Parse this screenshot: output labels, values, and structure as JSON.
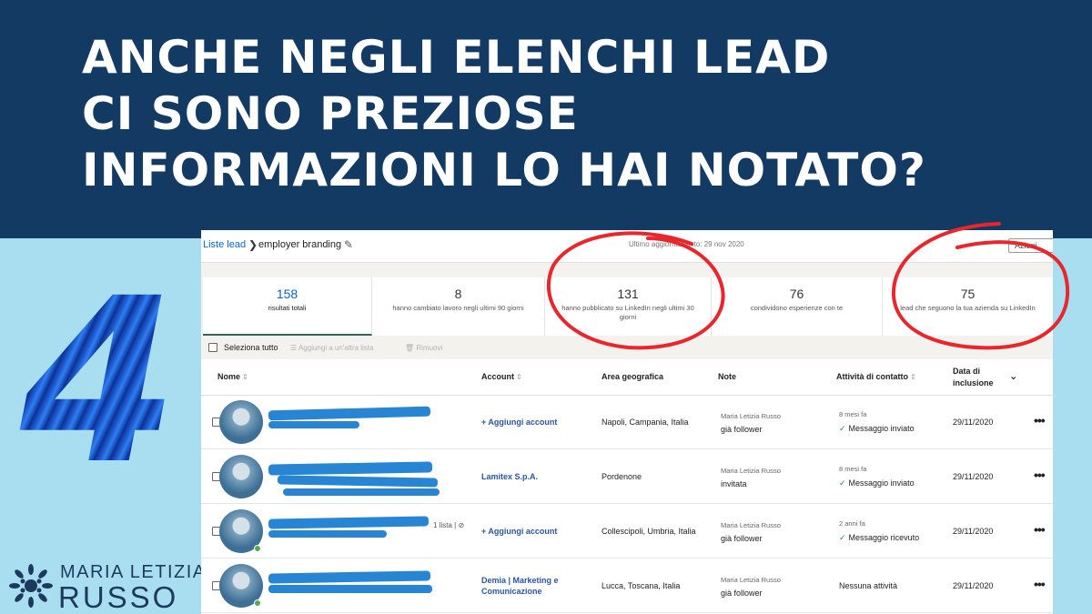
{
  "headline": {
    "line1": "ANCHE NEGLI ELENCHI LEAD",
    "line2": "CI SONO PREZIOSE",
    "line3": "INFORMAZIONI LO HAI NOTATO?"
  },
  "big_number": "4",
  "brand": {
    "top": "MARIA LETIZIA",
    "bottom": "RUSSO"
  },
  "topbar": {
    "breadcrumb_link": "Liste lead",
    "breadcrumb_current": "employer branding",
    "updated": "Ultimo aggiornamento: 29 nov 2020",
    "actions": "Azioni"
  },
  "stats": [
    {
      "value": "158",
      "label": "risultati totali"
    },
    {
      "value": "8",
      "label": "hanno cambiato lavoro negli ultimi 90 giorni"
    },
    {
      "value": "131",
      "label": "hanno pubblicato su LinkedIn negli ultimi 30 giorni"
    },
    {
      "value": "76",
      "label": "condividono esperienze con te"
    },
    {
      "value": "75",
      "label": "lead che seguono la tua azienda su LinkedIn"
    }
  ],
  "selection": {
    "select_all": "Seleziona tutto",
    "add_to_list": "Aggiungi a un'altra lista",
    "remove": "Rimuovi"
  },
  "columns": {
    "name": "Nome",
    "account": "Account",
    "geo": "Area geografica",
    "note": "Note",
    "activity": "Attività di contatto",
    "date_line1": "Data di",
    "date_line2": "inclusione"
  },
  "rows": [
    {
      "account": "+ Aggiungi account",
      "geo": "Napoli, Campania, Italia",
      "note_author": "Maria Letizia Russo",
      "note": "già follower",
      "activity_time": "8 mesi fa",
      "activity": "Messaggio inviato",
      "date": "29/11/2020"
    },
    {
      "account": "Lamitex S.p.A.",
      "geo": "Pordenone",
      "note_author": "Maria Letizia Russo",
      "note": "invitata",
      "activity_time": "8 mesi fa",
      "activity": "Messaggio inviato",
      "date": "29/11/2020"
    },
    {
      "list_tag": "1 lista",
      "account": "+ Aggiungi account",
      "geo": "Collescipoli, Umbria, Italia",
      "note_author": "Maria Letizia Russo",
      "note": "già follower",
      "activity_time": "2 anni fa",
      "activity": "Messaggio ricevuto",
      "date": "29/11/2020"
    },
    {
      "account": "Demia | Marketing e Comunicazione",
      "geo": "Lucca, Toscana, Italia",
      "note_author": "Maria Letizia Russo",
      "note": "già follower",
      "activity": "Nessuna attività",
      "date": "29/11/2020"
    }
  ],
  "colors": {
    "banner": "#133a62",
    "background": "#a9def0",
    "link": "#0a66c2",
    "annotation_red": "#e8262b",
    "redaction_blue": "#1b7ed1"
  }
}
